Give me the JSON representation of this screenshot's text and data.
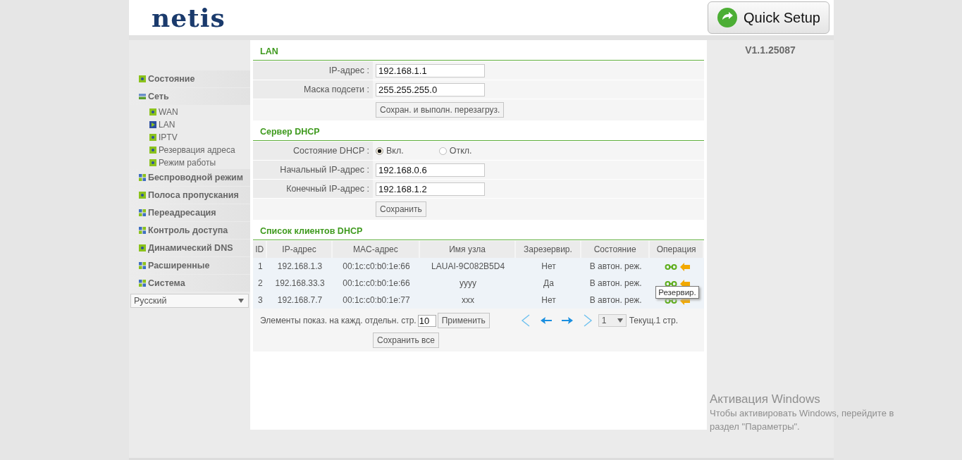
{
  "header": {
    "logo": "netis",
    "quick_setup": "Quick Setup"
  },
  "version": "V1.1.25087",
  "sidebar": {
    "items": [
      {
        "label": "Состояние",
        "kind": "page"
      },
      {
        "label": "Сеть",
        "kind": "folder",
        "expanded": true,
        "children": [
          {
            "label": "WAN",
            "selected": false
          },
          {
            "label": "LAN",
            "selected": true
          },
          {
            "label": "IPTV",
            "selected": false
          },
          {
            "label": "Резервация адреса",
            "selected": false
          },
          {
            "label": "Режим работы",
            "selected": false
          }
        ]
      },
      {
        "label": "Беспроводной режим",
        "kind": "folder",
        "expanded": false
      },
      {
        "label": "Полоса пропускания",
        "kind": "page"
      },
      {
        "label": "Переадресация",
        "kind": "folder",
        "expanded": false
      },
      {
        "label": "Контроль доступа",
        "kind": "folder",
        "expanded": false
      },
      {
        "label": "Динамический DNS",
        "kind": "page"
      },
      {
        "label": "Расширенные",
        "kind": "folder",
        "expanded": false
      },
      {
        "label": "Система",
        "kind": "folder",
        "expanded": false
      }
    ],
    "language": "Русский"
  },
  "lan": {
    "title": "LAN",
    "fields": [
      {
        "label": "IP-адрес :",
        "value": "192.168.1.1"
      },
      {
        "label": "Маска подсети :",
        "value": "255.255.255.0"
      }
    ],
    "button": "Сохран. и выполн. перезагруз."
  },
  "dhcp": {
    "title": "Сервер DHCP",
    "state_label": "Состояние DHCP :",
    "options": [
      {
        "label": "Вкл.",
        "selected": true
      },
      {
        "label": "Откл.",
        "selected": false
      }
    ],
    "fields": [
      {
        "label": "Начальный IP-адрес :",
        "value": "192.168.0.6"
      },
      {
        "label": "Конечный IP-адрес :",
        "value": "192.168.1.2"
      }
    ],
    "button": "Сохранить"
  },
  "clients": {
    "title": "Список клиентов DHCP",
    "columns": [
      "ID",
      "IP-адрес",
      "MAC-адрес",
      "Имя узла",
      "Зарезервир.",
      "Состояние",
      "Операция"
    ],
    "rows": [
      {
        "id": "1",
        "ip": "192.168.1.3",
        "mac": "00:1c:c0:b0:1e:66",
        "host": "LAUAI-9C082B5D4",
        "reserved": "Нет",
        "state": "В автон. реж."
      },
      {
        "id": "2",
        "ip": "192.168.33.3",
        "mac": "00:1c:c0:b0:1e:66",
        "host": "yyyy",
        "reserved": "Да",
        "state": "В автон. реж."
      },
      {
        "id": "3",
        "ip": "192.168.7.7",
        "mac": "00:1c:c0:b0:1e:77",
        "host": "xxx",
        "reserved": "Нет",
        "state": "В автон. реж."
      }
    ],
    "tooltip": "Резервир.",
    "per_page_label": "Элементы показ. на кажд. отдельн. стр.",
    "per_page": "10",
    "apply": "Применить",
    "page": "1",
    "current": "Текущ.1 стр.",
    "save_all": "Сохранить все"
  },
  "windows_activation": {
    "title": "Активация Windows",
    "text": "Чтобы активировать Windows, перейдите в раздел \"Параметры\"."
  }
}
